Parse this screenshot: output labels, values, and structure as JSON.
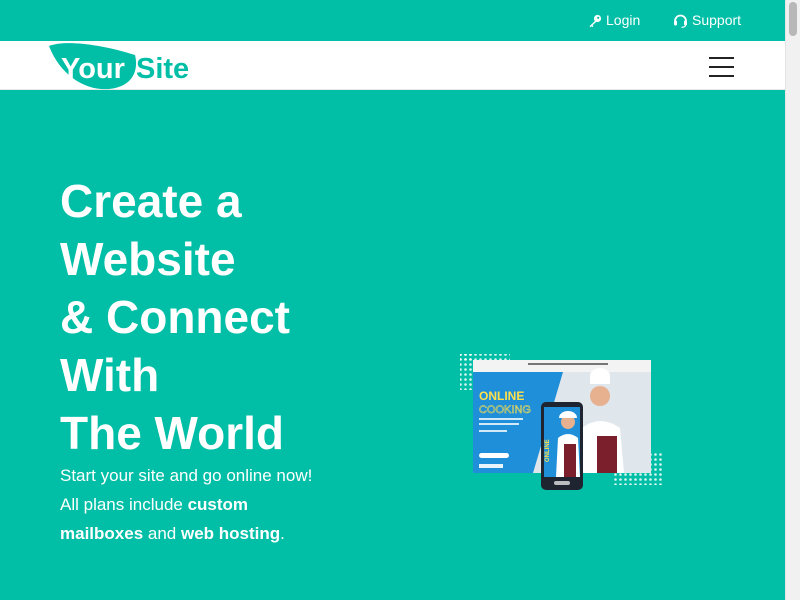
{
  "topbar": {
    "login_label": "Login",
    "support_label": "Support"
  },
  "header": {
    "logo_text_your": "Your",
    "logo_text_site": "Site"
  },
  "hero": {
    "title_lines": [
      "Create a",
      "Website",
      "& Connect",
      "With",
      "The World"
    ],
    "text_line1": "Start your site and go online now!",
    "text_part1": "All plans include ",
    "text_bold1": "custom",
    "text_bold2": "mailboxes",
    "text_part2": " and ",
    "text_bold3": "web hosting",
    "text_part3": "."
  },
  "illustration": {
    "banner_title": "ONLINE",
    "banner_subtitle": "COOKING",
    "phone_label": "ONLINE"
  },
  "colors": {
    "brand": "#00bfa6",
    "header_bg": "#ffffff",
    "text_light": "#ffffff"
  }
}
